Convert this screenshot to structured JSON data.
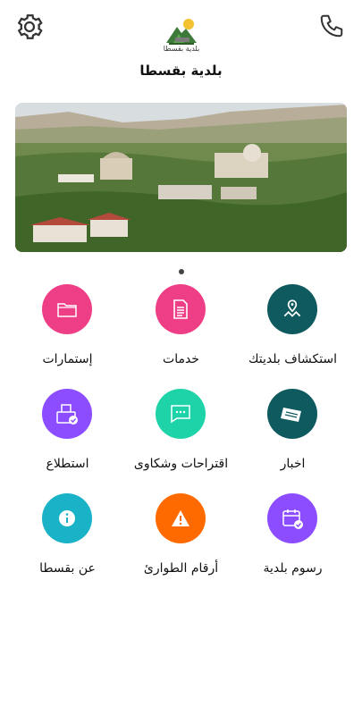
{
  "header": {
    "settings_icon": "gear-icon",
    "phone_icon": "phone-icon",
    "logo_caption": "بلدية بقسطا",
    "title": "بلدية بقسطا"
  },
  "carousel": {
    "active_index": 0,
    "count": 1
  },
  "grid": {
    "items": [
      {
        "label": "استكشاف بلديتك",
        "icon": "map-pin-icon",
        "color": "#0f5a5f"
      },
      {
        "label": "خدمات",
        "icon": "document-icon",
        "color": "#ee3f86"
      },
      {
        "label": "إستمارات",
        "icon": "folder-icon",
        "color": "#ee3f86"
      },
      {
        "label": "اخبار",
        "icon": "newspaper-icon",
        "color": "#0f5a5f"
      },
      {
        "label": "اقتراحات وشكاوى",
        "icon": "chat-icon",
        "color": "#1fd3a9"
      },
      {
        "label": "استطلاع",
        "icon": "ballot-box-icon",
        "color": "#8b4dff"
      },
      {
        "label": "رسوم بلدية",
        "icon": "calendar-check-icon",
        "color": "#8b4dff"
      },
      {
        "label": "أرقام الطوارئ",
        "icon": "warning-icon",
        "color": "#ff6a00"
      },
      {
        "label": "عن بقسطا",
        "icon": "info-icon",
        "color": "#19b2c7"
      }
    ]
  }
}
